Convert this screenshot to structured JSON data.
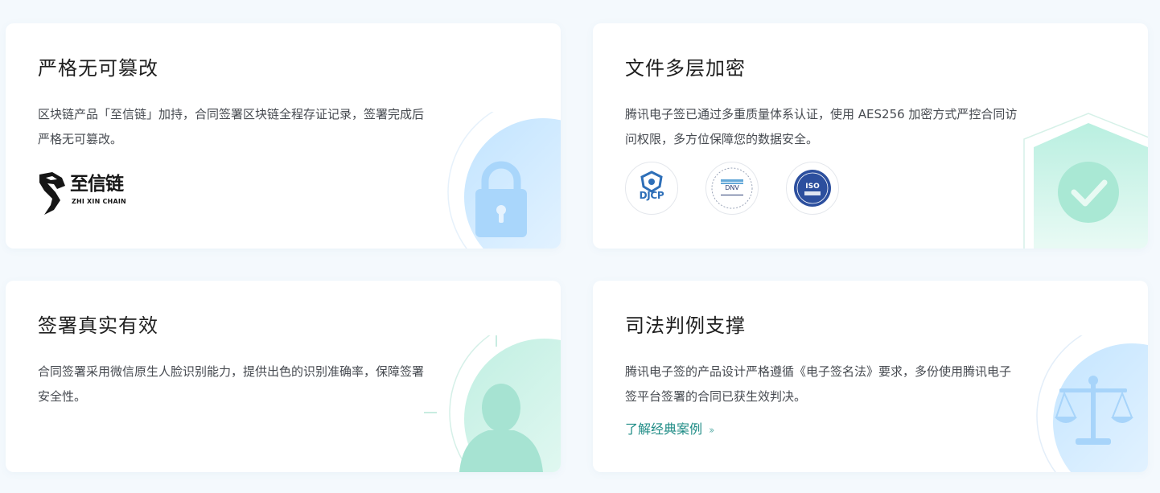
{
  "cards": [
    {
      "title": "严格无可篡改",
      "desc": "区块链产品「至信链」加持，合同签署区块链全程存证记录，签署完成后严格无可篡改。",
      "logo": {
        "name": "至信链",
        "subname": "ZHI XIN CHAIN"
      },
      "icon": "lock-icon"
    },
    {
      "title": "文件多层加密",
      "desc": "腾讯电子签已通过多重质量体系认证，使用 AES256 加密方式严控合同访问权限，多方位保障您的数据安全。",
      "certs": [
        "DJCP",
        "DNV",
        "ISO"
      ],
      "icon": "shield-check-icon"
    },
    {
      "title": "签署真实有效",
      "desc": "合同签署采用微信原生人脸识别能力，提供出色的识别准确率，保障签署安全性。",
      "icon": "user-avatar-icon"
    },
    {
      "title": "司法判例支撑",
      "desc": "腾讯电子签的产品设计严格遵循《电子签名法》要求，多份使用腾讯电子签平台签署的合同已获生效判决。",
      "link": "了解经典案例",
      "icon": "scale-icon"
    }
  ],
  "colors": {
    "accent": "#1f8c86",
    "blue_art": "#bfe3ff",
    "green_art": "#c8f0e6"
  }
}
